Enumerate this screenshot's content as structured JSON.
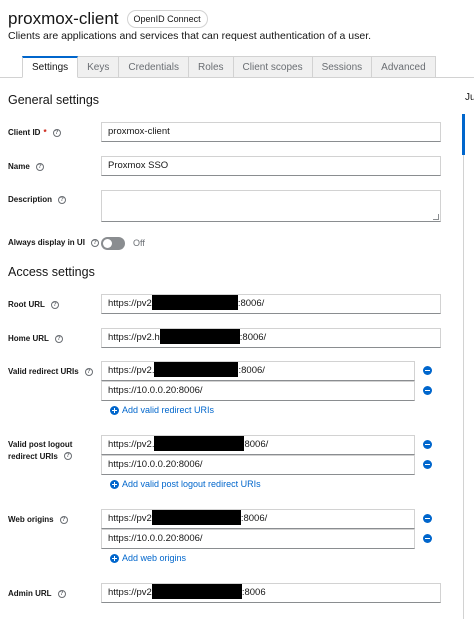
{
  "header": {
    "title": "proxmox-client",
    "badge": "OpenID Connect",
    "subtitle": "Clients are applications and services that can request authentication of a user."
  },
  "tabs": [
    {
      "label": "Settings",
      "active": true
    },
    {
      "label": "Keys"
    },
    {
      "label": "Credentials"
    },
    {
      "label": "Roles"
    },
    {
      "label": "Client scopes"
    },
    {
      "label": "Sessions"
    },
    {
      "label": "Advanced"
    }
  ],
  "jump_to": "Ju",
  "general": {
    "title": "General settings",
    "client_id": {
      "label": "Client ID",
      "required": "*",
      "value": "proxmox-client"
    },
    "name": {
      "label": "Name",
      "value": "Proxmox SSO"
    },
    "description": {
      "label": "Description",
      "value": ""
    },
    "always_display": {
      "label": "Always display in UI",
      "state": "Off"
    }
  },
  "access": {
    "title": "Access settings",
    "root_url": {
      "label": "Root URL",
      "prefix": "https://pv2",
      "suffix": ":8006/"
    },
    "home_url": {
      "label": "Home URL",
      "prefix": "https://pv2.h",
      "suffix": ":8006/"
    },
    "redirect": {
      "label": "Valid redirect URIs",
      "values": [
        {
          "prefix": "https://pv2.",
          "suffix": ":8006/"
        },
        {
          "text": "https://10.0.0.20:8006/"
        }
      ],
      "add": "Add valid redirect URIs"
    },
    "post_logout": {
      "label_line1": "Valid post logout",
      "label_line2": "redirect URIs",
      "values": [
        {
          "prefix": "https://pv2.",
          "suffix": "8006/"
        },
        {
          "text": "https://10.0.0.20:8006/"
        }
      ],
      "add": "Add valid post logout redirect URIs"
    },
    "web_origins": {
      "label": "Web origins",
      "values": [
        {
          "prefix": "https://pv2",
          "suffix": ":8006/"
        },
        {
          "text": "https://10.0.0.20:8006/"
        }
      ],
      "add": "Add web origins"
    },
    "admin_url": {
      "label": "Admin URL",
      "prefix": "https://pv2",
      "suffix": ":8006"
    }
  }
}
